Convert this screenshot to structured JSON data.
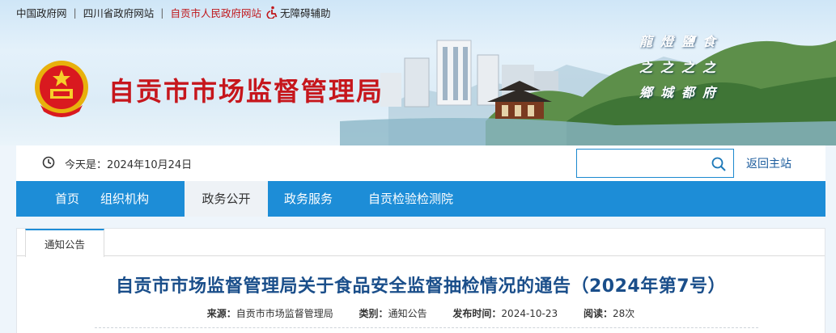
{
  "top_links": {
    "gov_cn": "中国政府网",
    "sichuan": "四川省政府网站",
    "zigong": "自贡市人民政府网站",
    "accessibility": "无障碍辅助"
  },
  "site": {
    "title": "自贡市市场监督管理局",
    "calligraphy": [
      "龍燈鹽食",
      "之之之之",
      "鄉城都府"
    ]
  },
  "infobar": {
    "today": "今天是：2024年10月24日",
    "search_placeholder": "",
    "back_home": "返回主站"
  },
  "nav": {
    "items": [
      {
        "label": "首页",
        "active": false
      },
      {
        "label": "组织机构",
        "active": false
      },
      {
        "label": "政务公开",
        "active": true
      },
      {
        "label": "政务服务",
        "active": false
      },
      {
        "label": "自贡检验检测院",
        "active": false
      }
    ]
  },
  "content": {
    "tab": "通知公告",
    "title": "自贡市市场监督管理局关于食品安全监督抽检情况的通告（2024年第7号）",
    "meta": {
      "source_label": "来源：",
      "source": "自贡市市场监督管理局",
      "category_label": "类别：",
      "category": "通知公告",
      "date_label": "发布时间：",
      "date": "2024-10-23",
      "reads_label": "阅读：",
      "reads": "28次"
    }
  },
  "colors": {
    "brand_red": "#c6161c",
    "nav_blue": "#1d8dd7",
    "title_blue": "#1a4e8a"
  }
}
